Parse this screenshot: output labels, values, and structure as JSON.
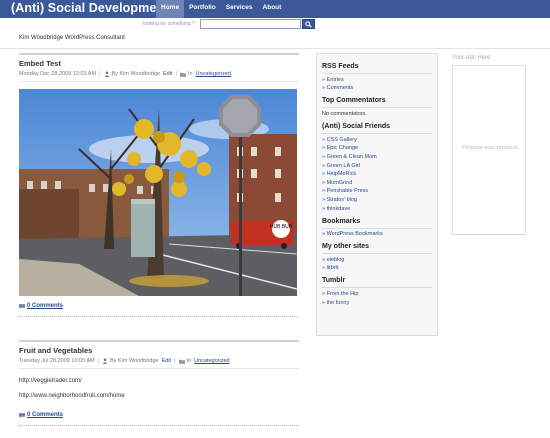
{
  "header": {
    "site_title": "(Anti) Social Development",
    "nav": [
      "Home",
      "Portfolio",
      "Services",
      "About"
    ],
    "search_placeholder": "looking for something ?",
    "search_button": "search",
    "tagline": "Kim Woodbridge WordPress Consultant"
  },
  "colors": {
    "topbar": "#3b5998",
    "active_tab": "#6d84b4",
    "link": "#2b4a8a"
  },
  "posts": [
    {
      "title": "Embed Test",
      "date": "Monday Dec 28,2009 12:03 AM",
      "author": "By Kim Woodbridge",
      "edit": "Edit",
      "in_label": "In",
      "category": "Uncategorized",
      "comments": "0 Comments"
    },
    {
      "title": "Fruit and Vegetables",
      "date": "Tuesday Jul 28,2009 10:05 AM",
      "author": "By Kim Woodbridge",
      "edit": "Edit",
      "in_label": "In",
      "category": "Uncategorized",
      "body": [
        "http://veggietrader.com/",
        "http://www.neighborhoodfruit.com/home"
      ],
      "comments": "0 Comments"
    }
  ],
  "sidebar": {
    "rss": {
      "title": "RSS Feeds",
      "items": [
        "Entries",
        "Comments"
      ]
    },
    "top_commentators": {
      "title": "Top Commentators",
      "text": "No commentators."
    },
    "friends": {
      "title": "(Anti) Social Friends",
      "items": [
        "CSS Gallery",
        "Epic Change",
        "Green & Clean Mom",
        "Green LA Girl",
        "HelpMeRick",
        "MomGrind",
        "Perishable Press",
        "Stratos' blog",
        "thinkdave"
      ]
    },
    "bookmarks": {
      "title": "Bookmarks",
      "items": [
        "WordPress Bookmarks"
      ]
    },
    "other_sites": {
      "title": "My other sites",
      "items": [
        "eleblog",
        "litbrit"
      ]
    },
    "tumblr": {
      "title": "Tumblr",
      "items": [
        "From the Hip",
        "the funny"
      ]
    }
  },
  "ads": {
    "label": "Your Ads Here",
    "promo": "Promote your products"
  },
  "photo_sign": {
    "text": "HUB BUB"
  }
}
